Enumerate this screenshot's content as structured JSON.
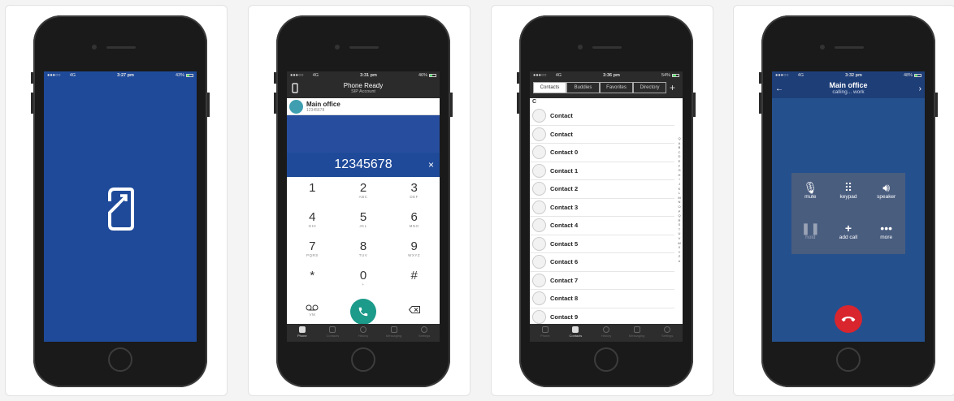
{
  "screens": {
    "splash": {
      "status": {
        "left": "●●●○○",
        "carrier": "4G",
        "time": "3:27 pm",
        "right": "43%"
      },
      "colors": {
        "background": "#1f4a99"
      }
    },
    "dialer": {
      "status": {
        "left": "●●●○○",
        "carrier": "4G",
        "time": "3:31 pm",
        "right": "46%"
      },
      "title": "Phone Ready",
      "subtitle": "SIP Account",
      "account": {
        "name": "Main office",
        "number": "12345678"
      },
      "entered_number": "12345678",
      "clear_glyph": "×",
      "keys": [
        {
          "digit": "1",
          "letters": ""
        },
        {
          "digit": "2",
          "letters": "ABC"
        },
        {
          "digit": "3",
          "letters": "DEF"
        },
        {
          "digit": "4",
          "letters": "GHI"
        },
        {
          "digit": "5",
          "letters": "JKL"
        },
        {
          "digit": "6",
          "letters": "MNO"
        },
        {
          "digit": "7",
          "letters": "PQRS"
        },
        {
          "digit": "8",
          "letters": "TUV"
        },
        {
          "digit": "9",
          "letters": "WXYZ"
        },
        {
          "digit": "*",
          "letters": ""
        },
        {
          "digit": "0",
          "letters": "+"
        },
        {
          "digit": "#",
          "letters": ""
        }
      ],
      "voicemail_label": "VM",
      "colors": {
        "call": "#1c9a8a",
        "number_bar": "#1f4a99"
      }
    },
    "contacts": {
      "status": {
        "left": "●●●○○",
        "carrier": "4G",
        "time": "3:36 pm",
        "right": "54%"
      },
      "segments": [
        "Contacts",
        "Buddies",
        "Favorites",
        "Directory"
      ],
      "section": "C",
      "rows": [
        "Contact",
        "Contact",
        "Contact 0",
        "Contact 1",
        "Contact 2",
        "Contact 3",
        "Contact 4",
        "Contact 5",
        "Contact 6",
        "Contact 7",
        "Contact 8",
        "Contact 9"
      ],
      "index_letters": [
        "Q",
        "A",
        "B",
        "C",
        "D",
        "E",
        "F",
        "G",
        "H",
        "I",
        "J",
        "K",
        "L",
        "M",
        "N",
        "O",
        "P",
        "Q",
        "R",
        "S",
        "T",
        "U",
        "V",
        "W",
        "X",
        "Y",
        "Z",
        "#"
      ]
    },
    "call": {
      "status": {
        "left": "●●●○○",
        "carrier": "4G",
        "time": "3:32 pm",
        "right": "48%"
      },
      "name": "Main office",
      "state": "calling... work",
      "buttons": [
        {
          "label": "mute",
          "icon": "microphone-icon"
        },
        {
          "label": "keypad",
          "icon": "keypad-icon"
        },
        {
          "label": "speaker",
          "icon": "speaker-icon"
        },
        {
          "label": "hold",
          "icon": "pause-icon"
        },
        {
          "label": "add call",
          "icon": "plus-icon"
        },
        {
          "label": "more",
          "icon": "more-icon"
        }
      ],
      "colors": {
        "end_call": "#d9252e",
        "background": "#25508e"
      }
    }
  },
  "tabbar": [
    "Phone",
    "Contacts",
    "History",
    "Messaging",
    "Settings"
  ]
}
